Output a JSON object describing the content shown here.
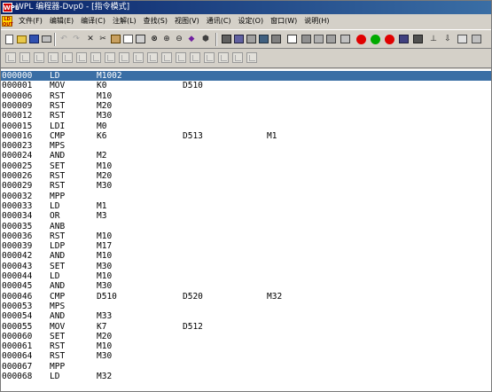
{
  "window": {
    "title": "WPL 编程器-Dvp0 - [指令模式]",
    "app_icon": "WPL"
  },
  "menu": {
    "doc_icon": "LD OUT",
    "items": [
      "文件(F)",
      "编辑(E)",
      "编译(C)",
      "注解(L)",
      "查找(S)",
      "视图(V)",
      "通讯(C)",
      "设定(O)",
      "窗口(W)",
      "说明(H)"
    ]
  },
  "toolbar1": [
    "new-file-icon",
    "open-folder-icon",
    "save-icon",
    "print-icon",
    "undo-icon",
    "redo-icon",
    "cut-icon",
    "copy-icon",
    "paste-icon",
    "delete-icon",
    "find-icon",
    "find-binoculars-icon",
    "zoom-in-icon",
    "zoom-out-icon",
    "compile-icon",
    "ladder-mode-icon",
    "instruction-mode-icon",
    "sfc-mode-icon",
    "device-monitor-icon",
    "comment-icon",
    "register-icon",
    "table-icon",
    "download-icon",
    "upload-icon",
    "run-icon",
    "stop-icon",
    "online-icon",
    "monitor-icon",
    "write-icon",
    "read-icon",
    "clear-icon"
  ],
  "toolbar2": [
    "contact-no-icon",
    "contact-nc-icon",
    "coil-icon",
    "function-icon",
    "rising-edge-icon",
    "falling-edge-icon",
    "invert-icon",
    "horizontal-line-icon",
    "vertical-line-icon",
    "delete-line-icon",
    "insert-row-icon",
    "delete-row-icon",
    "insert-col-icon",
    "delete-col-icon",
    "application-icon",
    "step-icon",
    "transfer-icon",
    "bracket-icon"
  ],
  "program": {
    "rows": [
      {
        "step": "000000",
        "op": "LD",
        "a1": "M1002",
        "a2": "",
        "a3": ""
      },
      {
        "step": "000001",
        "op": "MOV",
        "a1": "K0",
        "a2": "D510",
        "a3": ""
      },
      {
        "step": "000006",
        "op": "RST",
        "a1": "M10",
        "a2": "",
        "a3": ""
      },
      {
        "step": "000009",
        "op": "RST",
        "a1": "M20",
        "a2": "",
        "a3": ""
      },
      {
        "step": "000012",
        "op": "RST",
        "a1": "M30",
        "a2": "",
        "a3": ""
      },
      {
        "step": "000015",
        "op": "LDI",
        "a1": "M0",
        "a2": "",
        "a3": ""
      },
      {
        "step": "000016",
        "op": "CMP",
        "a1": "K6",
        "a2": "D513",
        "a3": "M1"
      },
      {
        "step": "000023",
        "op": "MPS",
        "a1": "",
        "a2": "",
        "a3": ""
      },
      {
        "step": "000024",
        "op": "AND",
        "a1": "M2",
        "a2": "",
        "a3": ""
      },
      {
        "step": "000025",
        "op": "SET",
        "a1": "M10",
        "a2": "",
        "a3": ""
      },
      {
        "step": "000026",
        "op": "RST",
        "a1": "M20",
        "a2": "",
        "a3": ""
      },
      {
        "step": "000029",
        "op": "RST",
        "a1": "M30",
        "a2": "",
        "a3": ""
      },
      {
        "step": "000032",
        "op": "MPP",
        "a1": "",
        "a2": "",
        "a3": ""
      },
      {
        "step": "000033",
        "op": "LD",
        "a1": "M1",
        "a2": "",
        "a3": ""
      },
      {
        "step": "000034",
        "op": "OR",
        "a1": "M3",
        "a2": "",
        "a3": ""
      },
      {
        "step": "000035",
        "op": "ANB",
        "a1": "",
        "a2": "",
        "a3": ""
      },
      {
        "step": "000036",
        "op": "RST",
        "a1": "M10",
        "a2": "",
        "a3": ""
      },
      {
        "step": "000039",
        "op": "LDP",
        "a1": "M17",
        "a2": "",
        "a3": ""
      },
      {
        "step": "000042",
        "op": "AND",
        "a1": "M10",
        "a2": "",
        "a3": ""
      },
      {
        "step": "000043",
        "op": "SET",
        "a1": "M30",
        "a2": "",
        "a3": ""
      },
      {
        "step": "000044",
        "op": "LD",
        "a1": "M10",
        "a2": "",
        "a3": ""
      },
      {
        "step": "000045",
        "op": "AND",
        "a1": "M30",
        "a2": "",
        "a3": ""
      },
      {
        "step": "000046",
        "op": "CMP",
        "a1": "D510",
        "a2": "D520",
        "a3": "M32"
      },
      {
        "step": "000053",
        "op": "MPS",
        "a1": "",
        "a2": "",
        "a3": ""
      },
      {
        "step": "000054",
        "op": "AND",
        "a1": "M33",
        "a2": "",
        "a3": ""
      },
      {
        "step": "000055",
        "op": "MOV",
        "a1": "K7",
        "a2": "D512",
        "a3": ""
      },
      {
        "step": "000060",
        "op": "SET",
        "a1": "M20",
        "a2": "",
        "a3": ""
      },
      {
        "step": "000061",
        "op": "RST",
        "a1": "M10",
        "a2": "",
        "a3": ""
      },
      {
        "step": "000064",
        "op": "RST",
        "a1": "M30",
        "a2": "",
        "a3": ""
      },
      {
        "step": "000067",
        "op": "MPP",
        "a1": "",
        "a2": "",
        "a3": ""
      },
      {
        "step": "000068",
        "op": "LD",
        "a1": "M32",
        "a2": "",
        "a3": ""
      }
    ]
  }
}
